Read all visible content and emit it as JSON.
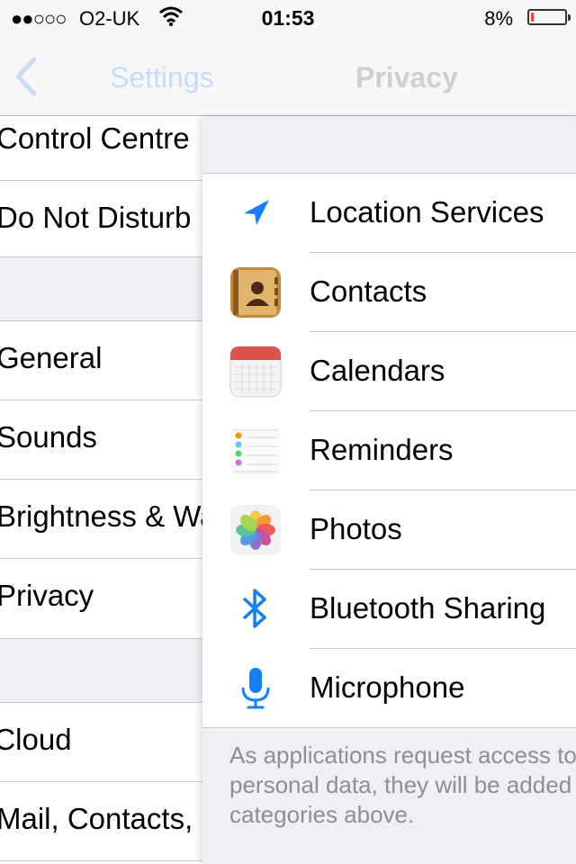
{
  "status_bar": {
    "signal": "●●○○○",
    "carrier": "O2-UK",
    "time": "01:53",
    "battery_percent": "8%",
    "battery_level": 0.08,
    "battery_color": "#ff3b30"
  },
  "nav": {
    "back_label": "Settings",
    "title": "Privacy"
  },
  "settings_list": {
    "items": [
      {
        "label": "Control Centre"
      },
      {
        "label": "Do Not Disturb"
      },
      {
        "label": "General"
      },
      {
        "label": "Sounds"
      },
      {
        "label": "Brightness & Wallpaper"
      },
      {
        "label": "Privacy"
      },
      {
        "label": "iCloud"
      },
      {
        "label": "Mail, Contacts, Calendars"
      }
    ]
  },
  "privacy": {
    "items": [
      {
        "label": "Location Services",
        "icon": "location-arrow-icon"
      },
      {
        "label": "Contacts",
        "icon": "contacts-app-icon"
      },
      {
        "label": "Calendars",
        "icon": "calendar-app-icon"
      },
      {
        "label": "Reminders",
        "icon": "reminders-app-icon"
      },
      {
        "label": "Photos",
        "icon": "photos-app-icon"
      },
      {
        "label": "Bluetooth Sharing",
        "icon": "bluetooth-icon"
      },
      {
        "label": "Microphone",
        "icon": "microphone-icon"
      }
    ],
    "footer_line1": "As applications request access to your",
    "footer_line2": "personal data, they will be added in the",
    "footer_line3": "categories above."
  },
  "colors": {
    "accent": "#147efb",
    "background": "#efeff4",
    "separator": "#c8c7cc",
    "footer_text": "#8e8e93"
  }
}
